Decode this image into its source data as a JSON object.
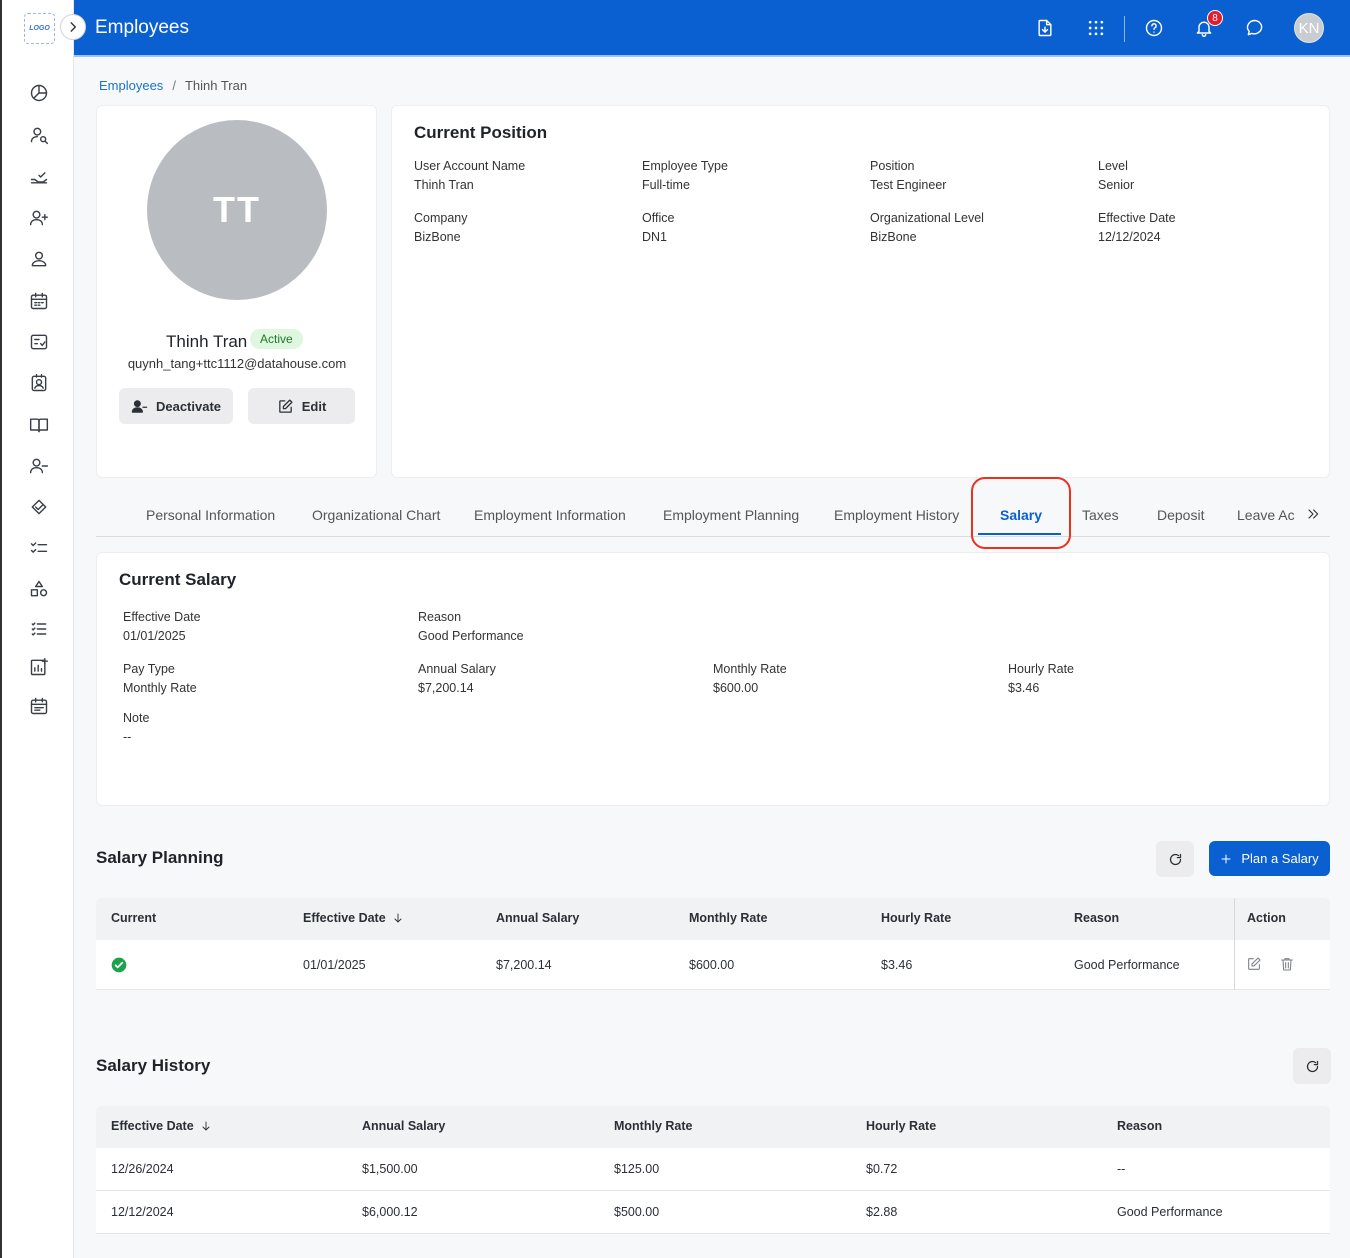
{
  "app": {
    "logo_text": "LOGO",
    "page_title": "Employees",
    "notification_count": "8",
    "user_initials": "KN"
  },
  "breadcrumb": {
    "root": "Employees",
    "current": "Thinh Tran"
  },
  "profile": {
    "initials": "TT",
    "name": "Thinh Tran",
    "status": "Active",
    "email": "quynh_tang+ttc1112@datahouse.com",
    "deactivate_label": "Deactivate",
    "edit_label": "Edit"
  },
  "current_position": {
    "title": "Current Position",
    "fields": [
      {
        "label": "User Account Name",
        "value": "Thinh Tran"
      },
      {
        "label": "Employee Type",
        "value": "Full-time"
      },
      {
        "label": "Position",
        "value": "Test Engineer"
      },
      {
        "label": "Level",
        "value": "Senior"
      },
      {
        "label": "Company",
        "value": "BizBone"
      },
      {
        "label": "Office",
        "value": "DN1"
      },
      {
        "label": "Organizational Level",
        "value": "BizBone"
      },
      {
        "label": "Effective Date",
        "value": "12/12/2024"
      }
    ]
  },
  "tabs": [
    {
      "label": "Personal Information"
    },
    {
      "label": "Organizational Chart"
    },
    {
      "label": "Employment Information"
    },
    {
      "label": "Employment Planning"
    },
    {
      "label": "Employment History"
    },
    {
      "label": "Salary"
    },
    {
      "label": "Taxes"
    },
    {
      "label": "Deposit"
    },
    {
      "label": "Leave Ac"
    }
  ],
  "current_salary": {
    "title": "Current Salary",
    "fields": [
      {
        "label": "Effective Date",
        "value": "01/01/2025"
      },
      {
        "label": "Reason",
        "value": "Good Performance"
      },
      {
        "label": "Pay Type",
        "value": "Monthly Rate"
      },
      {
        "label": "Annual Salary",
        "value": "$7,200.14"
      },
      {
        "label": "Monthly Rate",
        "value": "$600.00"
      },
      {
        "label": "Hourly Rate",
        "value": "$3.46"
      },
      {
        "label": "Note",
        "value": "--"
      }
    ]
  },
  "salary_planning": {
    "title": "Salary Planning",
    "plan_button": "Plan a Salary",
    "columns": [
      "Current",
      "Effective Date",
      "Annual Salary",
      "Monthly Rate",
      "Hourly Rate",
      "Reason",
      "Action"
    ],
    "rows": [
      {
        "effective_date": "01/01/2025",
        "annual_salary": "$7,200.14",
        "monthly_rate": "$600.00",
        "hourly_rate": "$3.46",
        "reason": "Good Performance"
      }
    ]
  },
  "salary_history": {
    "title": "Salary History",
    "columns": [
      "Effective Date",
      "Annual Salary",
      "Monthly Rate",
      "Hourly Rate",
      "Reason"
    ],
    "rows": [
      {
        "effective_date": "12/26/2024",
        "annual_salary": "$1,500.00",
        "monthly_rate": "$125.00",
        "hourly_rate": "$0.72",
        "reason": "--"
      },
      {
        "effective_date": "12/12/2024",
        "annual_salary": "$6,000.12",
        "monthly_rate": "$500.00",
        "hourly_rate": "$2.88",
        "reason": "Good Performance"
      }
    ]
  },
  "colors": {
    "primary": "#0a5fd1",
    "highlight": "#e8321e",
    "success": "#1aa34a"
  }
}
